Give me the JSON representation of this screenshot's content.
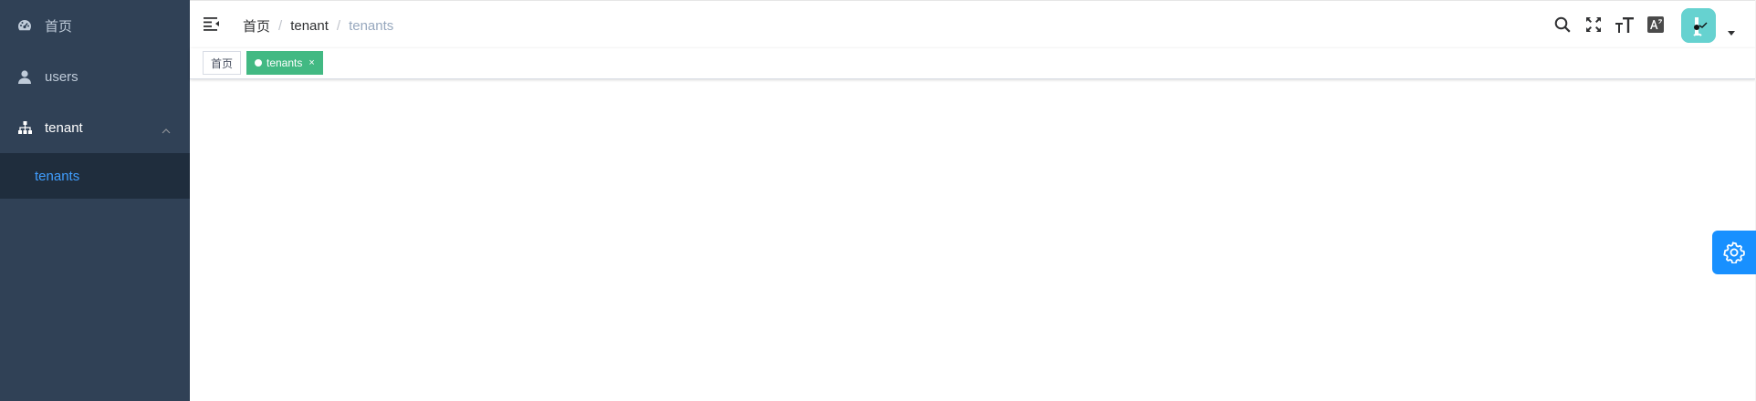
{
  "sidebar": {
    "items": [
      {
        "label": "首页",
        "icon": "dashboard-icon"
      },
      {
        "label": "users",
        "icon": "user-icon"
      },
      {
        "label": "tenant",
        "icon": "tree-icon",
        "expanded": true,
        "children": [
          {
            "label": "tenants",
            "active": true
          }
        ]
      }
    ]
  },
  "navbar": {
    "breadcrumb": [
      "首页",
      "tenant",
      "tenants"
    ],
    "icons": [
      "search-icon",
      "fullscreen-icon",
      "font-size-icon",
      "language-icon"
    ],
    "avatar": {
      "icon": "avatar-image"
    }
  },
  "tags": [
    {
      "label": "首页",
      "active": false
    },
    {
      "label": "tenants",
      "active": true,
      "close": "×"
    }
  ],
  "colors": {
    "sidebar_bg": "#304156",
    "sidebar_sub_bg": "#1f2d3d",
    "sidebar_active_text": "#409eff",
    "tag_active": "#42b983",
    "settings_button": "#1890ff",
    "avatar_bg": "#66d2d0"
  },
  "settings": {
    "icon": "gear-icon"
  }
}
